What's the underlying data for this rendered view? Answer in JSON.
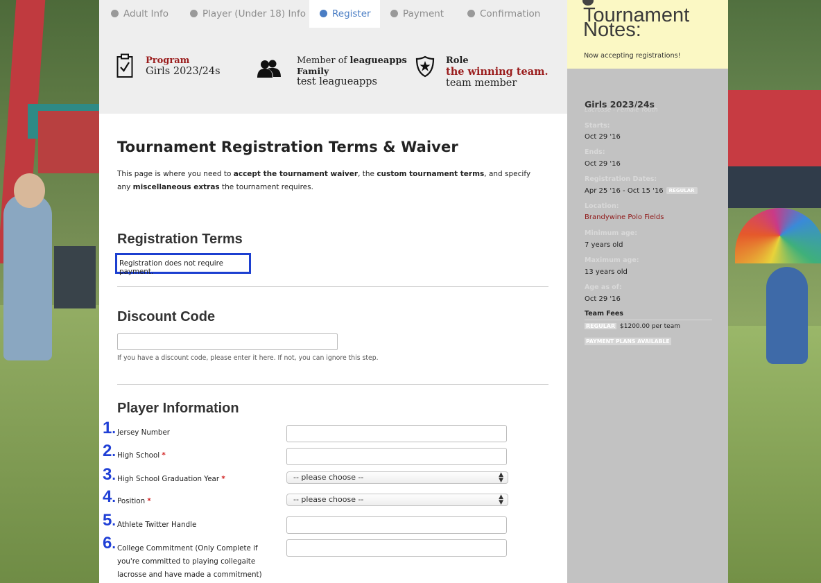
{
  "steps": [
    "Adult Info",
    "Player (Under 18) Info",
    "Register",
    "Payment",
    "Confirmation"
  ],
  "active_step": "Register",
  "info": {
    "program_title": "Program",
    "program_value": "Girls 2023/24s",
    "member_prefix": "Member of",
    "member_org": "leagueapps",
    "member_family": "Family",
    "member_value": "test leagueapps",
    "role_title": "Role",
    "role_highlight": "the winning team.",
    "role_value": "team member"
  },
  "page": {
    "title": "Tournament Registration Terms & Waiver",
    "intro_parts": [
      "This page is where you need to ",
      "accept the tournament waiver",
      ", the ",
      "custom tournament terms",
      ", and specify any ",
      "miscellaneous extras",
      " the tournament requires."
    ]
  },
  "registration_terms": {
    "heading": "Registration Terms",
    "text": "Registration does not require payment."
  },
  "discount": {
    "heading": "Discount Code",
    "value": "",
    "help": "If you have a discount code, please enter it here. If not, you can ignore this step."
  },
  "player_info": {
    "heading": "Player Information",
    "fields": [
      {
        "number": "1",
        "label": "Jersey Number",
        "required": false,
        "type": "text",
        "value": ""
      },
      {
        "number": "2",
        "label": "High School",
        "required": true,
        "type": "text",
        "value": ""
      },
      {
        "number": "3",
        "label": "High School Graduation Year",
        "required": true,
        "type": "select",
        "value": "-- please choose --"
      },
      {
        "number": "4",
        "label": "Position",
        "required": true,
        "type": "select",
        "value": "-- please choose --"
      },
      {
        "number": "5",
        "label": "Athlete Twitter Handle",
        "required": false,
        "type": "text",
        "value": ""
      },
      {
        "number": "6",
        "label": "College Commitment (Only Complete if you're committed to playing collegaite lacrosse and have made a commitment)",
        "required": false,
        "type": "text",
        "value": ""
      }
    ],
    "required_marker": "*"
  },
  "sidebar": {
    "notes_title": "Tournament Notes:",
    "notes_text": "Now accepting registrations!",
    "program": "Girls 2023/24s",
    "sport": "Lacrosse - Female Youth",
    "starts_label": "Starts:",
    "starts_value": "Oct 29 '16",
    "ends_label": "Ends:",
    "ends_value": "Oct 29 '16",
    "reg_dates_label": "Registration Dates:",
    "reg_dates_value": "Apr 25 '16 - Oct 15 '16",
    "reg_badge": "REGULAR",
    "location_label": "Location:",
    "location_value": "Brandywine Polo Fields",
    "min_age_label": "Minimum age:",
    "min_age_value": "7 years old",
    "max_age_label": "Maximum age:",
    "max_age_value": "13 years old",
    "age_as_of_label": "Age as of:",
    "age_as_of_value": "Oct 29 '16",
    "team_fees_label": "Team Fees",
    "fee_tag": "REGULAR",
    "fee_value": "$1200.00 per team",
    "payment_plans": "PAYMENT PLANS AVAILABLE"
  },
  "colors": {
    "active_step": "#4a7dc4",
    "accent_red": "#9a1c1c",
    "annotation_blue": "#1f3fd6",
    "notes_bg": "#fbf8c4",
    "sidebar_bg": "#c2c2c2"
  },
  "icons": [
    "clipboard-check-icon",
    "users-icon",
    "star-shield-icon",
    "chevron-updown-icon"
  ]
}
